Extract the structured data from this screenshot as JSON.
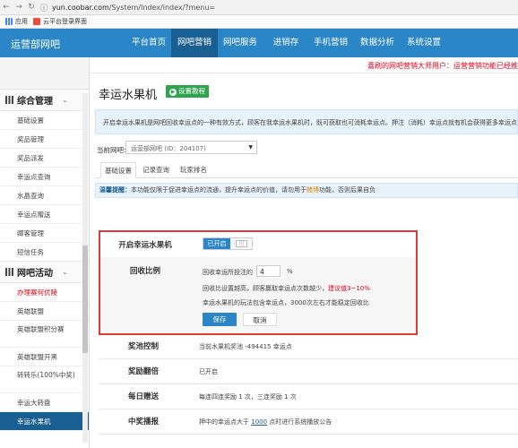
{
  "browser": {
    "url_host": "yun.coobar.com",
    "url_path": "/System/Index/index/?menu=",
    "bookmarks": [
      "应用",
      "云平台登录界面"
    ]
  },
  "topnav": {
    "brand": "运营部网吧",
    "items": [
      "平台首页",
      "网吧营销",
      "网吧服务",
      "进销存",
      "手机营销",
      "数据分析",
      "系统设置"
    ],
    "active_index": 1
  },
  "notice": "喜刷的网吧营销大师用户：运营营销功能已经推",
  "sidebar": {
    "sections": [
      {
        "title": "综合管理",
        "items": [
          "基础设置",
          "奖品管理",
          "奖品派发",
          "幸运点查询",
          "水晶查询",
          "幸运点赠送",
          "卿客管理",
          "短信任务"
        ]
      },
      {
        "title": "网吧活动",
        "items": [
          "办理赛何优陵",
          "英雄联盟",
          "英雄联盟积分赛",
          "英雄联盟开黑",
          "转转乐(100%中奖)",
          "幸运大转盘",
          "幸运水果机"
        ]
      }
    ],
    "highlight_item": "办理赛何优陵",
    "active_item": "幸运水果机"
  },
  "main": {
    "title": "幸运水果机",
    "tutorial_button": "设置教程",
    "intro": "开启幸运水果机是网吧回收幸运点的一种有效方式，顾客在我幸运水果机时，既可获取也可消耗幸运点。押注（消耗）幸运点就有机会获得更多幸运点，",
    "cafe_label": "当前网吧:",
    "cafe_select": "运营部网吧 (ID：204107)",
    "tabs": [
      "基础设置",
      "记录查询",
      "玩家排名"
    ],
    "active_tab": 0,
    "tip_label": "温馨提醒：",
    "tip_text_1": "本功能仅限于促进幸运点的流通，提升幸运点的价值，请勿用于",
    "tip_text_highlight": "赌博",
    "tip_text_2": "功能，否则后果自负"
  },
  "settings": {
    "enable_label": "开启幸运水果机",
    "enable_state": "已开启",
    "knob_text": "|||",
    "recycle_label": "回收比例",
    "recycle_prefix": "回收幸运所投注的",
    "recycle_value": "4",
    "recycle_unit": "%",
    "hint1_prefix": "回收比设置越高，顾客赢取幸运点次数越少，",
    "hint1_red": "建议值3~10%",
    "hint2": "幸运水果机的玩法包含幸运点，3000次左右才能稳定回收比",
    "save_button": "保存",
    "cancel_button": "取消"
  },
  "rows": [
    {
      "label": "奖池控制",
      "value": "当前水果机奖池 -494415 幸运点"
    },
    {
      "label": "奖励翻倍",
      "value": "已开启"
    },
    {
      "label": "每日赠送",
      "value": "每连四连奖励 1 次，三连奖励 1 次"
    },
    {
      "label": "中奖播报",
      "value_prefix": "押中的幸运点大于",
      "value_link": "1000",
      "value_suffix": "点时进行系统播放公告"
    }
  ]
}
